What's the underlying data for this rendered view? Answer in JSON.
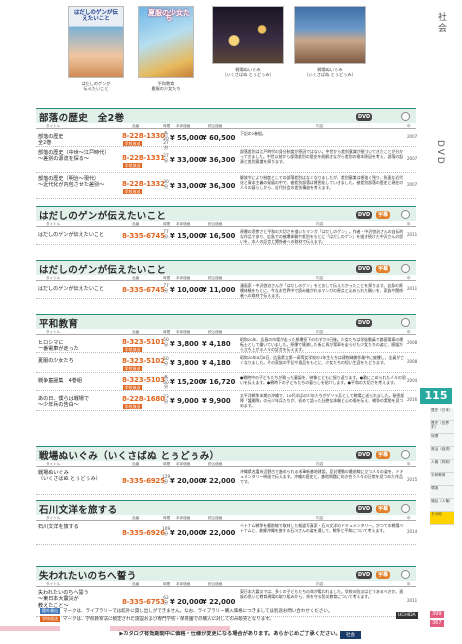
{
  "thumbnails": [
    {
      "caption_1": "はだしのゲンが",
      "caption_2": "伝えたいこと",
      "cover_title": "はだしのゲンが伝えたいこと"
    },
    {
      "caption_1": "平和教育",
      "caption_2": "夏服の少女たち",
      "cover_title": "夏服の少女たち"
    },
    {
      "caption_1": "戦場ぬいぐみ",
      "caption_2": "（いくさばぬ とぅどぅみ）"
    },
    {
      "caption_1": "戦場ぬいぐみ",
      "caption_2": "（いくさばぬ とぅどぅみ）"
    }
  ],
  "header_labels": {
    "title": "タイトル",
    "code": "品番",
    "minutes": "時間",
    "price1": "本体価格",
    "price2": "税込価格",
    "desc": "内容",
    "year": "年"
  },
  "sections": [
    {
      "title": "部落の歴史　全2巻",
      "badges": [
        "DVD"
      ],
      "rows": [
        {
          "title": "部落の歴史\n全2巻",
          "code": "8-228-1330",
          "tag": "学校放送",
          "minutes": "各20 27分",
          "price1": "¥ 55,000",
          "price2": "¥ 60,500",
          "desc": "下記の2巻組。",
          "year": "2007"
        },
        {
          "title": "部落の歴史（中世～江戸時代）\n～差別の源流を探る～",
          "code": "8-228-1331",
          "tag": "学校放送",
          "minutes": "27分",
          "price1": "¥ 33,000",
          "price2": "¥ 36,300",
          "desc": "部落差別は江戸時代の身分制度が原因ではない。中世から差別意識が根づいてきたことが分かってきました。中世以前から部落差別の歴史を紐解きながら差別の根本原因を考え、部落の起源と差別意識を探ります。",
          "year": "2007"
        },
        {
          "title": "部落の歴史（明治～現代）\n～近代化が内包させた差別～",
          "code": "8-228-1332",
          "tag": "学校放送",
          "minutes": "30分",
          "price1": "¥ 33,000",
          "price2": "¥ 36,300",
          "desc": "解放令により制度としての部落差別はなくなりましたが、差別意識は根強く残り、急速な近代化と資本主義の発展の中で、被差別部落は貧困化していきました。被差別部落の歴史と現在の人々の暮らしから、近代社会の差別構造を考えます。",
          "year": "2007"
        }
      ]
    },
    {
      "title": "はだしのゲンが伝えたいこと",
      "badges": [
        "DVD",
        "字幕"
      ],
      "rows": [
        {
          "title": "はだしのゲンが伝えたいこと",
          "code": "8-335-6745",
          "tag": "",
          "minutes": "77分",
          "price1": "¥ 15,000",
          "price2": "¥ 16,500",
          "desc": "原爆の悲惨さと平和の大切さを描いたマンガ「はだしのゲン」。作者・中沢啓治さんの自伝的な作品であり、広島での被爆体験や差別をもとに「はだしのゲン」を描き続けた中沢さんの思いを、本人の証言と関係者への取材で伝えます。",
          "year": "2011"
        }
      ]
    },
    {
      "title": "はだしのゲンが伝えたいこと",
      "badges": [
        "DVD",
        "字幕"
      ],
      "rows": [
        {
          "title": "はだしのゲンが伝えたいこと",
          "code": "8-335-6745",
          "tag": "",
          "minutes": "77分",
          "price1": "¥ 10,000",
          "price2": "¥ 11,000",
          "desc": "漫画家・中沢啓治さんが「はだしのゲン」をとおして伝えたかったことを探ります。自身の原爆体験をもとに、今なお世界中で読み継がれるマンガの原点と込められた願いを、家族や関係者への取材で伝えます。",
          "year": "2011"
        }
      ]
    },
    {
      "title": "平和教育",
      "badges": [
        "DVD"
      ],
      "rows": [
        {
          "title": "ヒロシマに\n一番電車が走った",
          "code": "8-323-5101",
          "tag": "学校放送",
          "minutes": "50分",
          "price1": "¥ 3,800",
          "price2": "¥ 4,180",
          "desc": "昭和20年、広島の市電が走った原爆投下のわずか3日後。少女たちは学徒動員で路面電車の運転士として働いていました。原爆で壊滅した街に再び電車を走らせた少女たちの姿と、廃墟から立ち上がる人々の証言を伝えます。",
          "year": "2008"
        },
        {
          "title": "夏服の少女たち",
          "code": "8-323-5102",
          "tag": "学校放送",
          "minutes": "50分",
          "price1": "¥ 3,800",
          "price2": "¥ 4,180",
          "desc": "昭和20年8月6日、広島県立第一高等女学校の1年生たちは建物疎開作業中に被爆し、全員が亡くなりました。その家族の手記や遺品をもとに、少女たちの短い生涯をたどります。",
          "year": "2008"
        },
        {
          "title": "戦争童謡集　4巻組",
          "code": "8-323-5103",
          "tag": "学校放送",
          "minutes": "各60分",
          "price1": "¥ 15,200",
          "price2": "¥ 16,720",
          "desc": "●戦時中の子どもたちが歌った童謡を、映像とともに振り返ります。●歌にこめられた人々の思いを伝えます。●戦時下の子どもたちの暮らしを紹介します。●平和の大切さを考えます。",
          "year": "2004"
        },
        {
          "title": "あの日、僕らは戦場で\n～少年兵の告白～",
          "code": "8-228-1680",
          "tag": "学校放送",
          "minutes": "73分",
          "price1": "¥ 9,000",
          "price2": "¥ 9,900",
          "desc": "太平洋戦争末期の沖縄で、10代半ばの少年たちがゲリラ兵として戦場に送られました。秘密部隊「護郷隊」の元少年兵たちが、初めて語った壮絶な体験と心の傷を伝え、戦争の実態を見つめます。",
          "year": "2016"
        }
      ]
    },
    {
      "title": "戦場ぬいぐみ（いくさばぬ とぅどぅみ）",
      "badges": [
        "DVD",
        "字幕"
      ],
      "rows": [
        {
          "title": "戦場ぬいぐみ\n（いくさばぬ とぅどぅみ）",
          "code": "8-335-6925",
          "tag": "",
          "minutes": "129分",
          "price1": "¥ 20,000",
          "price2": "¥ 22,000",
          "desc": "沖縄県名護市辺野古で進められる米軍新基地建設。反対運動の最前線に立つ人々の姿を、ドキュメンタリー映画で伝えます。沖縄の歴史と、基地問題に向き合う人々の日常を見つめた作品です。",
          "year": "2015"
        }
      ]
    },
    {
      "title": "石川文洋を旅する",
      "badges": [
        "DVD",
        "字幕"
      ],
      "rows": [
        {
          "title": "石川文洋を旅する",
          "code": "8-335-6926",
          "tag": "",
          "minutes": "109分",
          "price1": "¥ 20,000",
          "price2": "¥ 22,000",
          "desc": "ベトナム戦争を最前線で取材した報道写真家・石川文洋のドキュメンタリー。かつての戦場ベトナムと、故郷沖縄を旅する石川さんの姿を通して、戦争と平和について考えます。",
          "year": "2014"
        }
      ]
    },
    {
      "title": "失われたいのちへ誓う",
      "badges": [
        "DVD",
        "字幕"
      ],
      "rows": [
        {
          "title": "失われたいのちへ誓う\n～東日本大震災が\n教えたこと～",
          "code": "8-335-6753",
          "tag": "",
          "minutes": "62分",
          "price1": "¥ 20,000",
          "price2": "¥ 22,000",
          "desc": "東日本大震災では、多くの子どもたちの命が奪われました。学校の防災はどうあるべきか。遺族の思いと教育現場の取り組みから、命を守る防災教育について考えます。",
          "year": "2011"
        }
      ]
    }
  ],
  "sidebar": {
    "vertical_1": "社会",
    "vertical_2": "DVD",
    "page_number": "115",
    "categories": [
      "歴史（日本）",
      "歴史（世界史）",
      "地理",
      "政治（経済）",
      "人権（同和）",
      "平和教育",
      "環境",
      "福祉（人権）",
      "その他"
    ],
    "active_index": 8,
    "page_refs": [
      "399",
      "367"
    ]
  },
  "footer": {
    "line1_badge": "館外貸出",
    "line1": "マークは、ライブラリーでは館外に貸し出しができません。なお、ライブラリー購入価格につきましては別途お問い合わせください。",
    "line2_badge": "学校放送",
    "line2": "マークは、学校教育法に規定された施設および専門学校・保育園での購入に対してのみ販売となります。",
    "notice": "▶カタログ有効期間中に価格・仕様が変更になる場合があります。あらかじめご了承ください。",
    "publisher": "UCHIDA",
    "section_badge": "社会"
  }
}
